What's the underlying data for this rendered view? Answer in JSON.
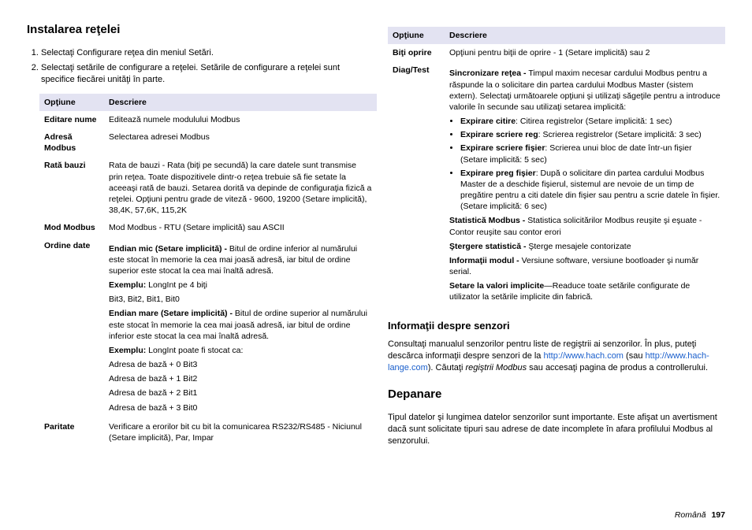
{
  "left": {
    "h2": "Instalarea reţelei",
    "steps": [
      "Selectaţi Configurare reţea din meniul Setări.",
      "Selectaţi setările de configurare a reţelei. Setările de configurare a reţelei sunt specifice fiecărei unităţi în parte."
    ],
    "th1": "Opţiune",
    "th2": "Descriere",
    "rows": {
      "editare_nume_k": "Editare nume",
      "editare_nume_v": "Editează numele modulului Modbus",
      "adresa_k": "Adresă Modbus",
      "adresa_v": "Selectarea adresei Modbus",
      "rata_k": "Rată bauzi",
      "rata_v": "Rata de bauzi - Rata (biţi pe secundă) la care datele sunt transmise prin reţea. Toate dispozitivele dintr-o reţea trebuie să fie setate la aceeaşi rată de bauzi. Setarea dorită va depinde de configuraţia fizică a reţelei. Opţiuni pentru grade de viteză - 9600, 19200 (Setare implicită), 38,4K, 57,6K, 115,2K",
      "mod_k": "Mod Modbus",
      "mod_v": "Mod Modbus - RTU (Setare implicită) sau ASCII",
      "ord_k": "Ordine date",
      "ord_little_b": "Endian mic (Setare implicită) - ",
      "ord_little_t": "Bitul de ordine inferior al numărului este stocat în memorie la cea mai joasă adresă, iar bitul de ordine superior este stocat la cea mai înaltă adresă.",
      "ord_ex_b": "Exemplu:",
      "ord_ex_t": " LongInt pe 4 biţi",
      "ord_bits": "Bit3, Bit2, Bit1, Bit0",
      "ord_big_b": "Endian mare (Setare implicită) - ",
      "ord_big_t": "Bitul de ordine superior al numărului este stocat în memorie la cea mai joasă adresă, iar bitul de ordine inferior este stocat la cea mai înaltă adresă.",
      "ord_ex2_t": " LongInt poate fi stocat ca:",
      "addr0": "Adresa de bază + 0 Bit3",
      "addr1": "Adresa de bază + 1 Bit2",
      "addr2": "Adresa de bază + 2 Bit1",
      "addr3": "Adresa de bază + 3 Bit0",
      "par_k": "Paritate",
      "par_v": "Verificare a erorilor bit cu bit la comunicarea RS232/RS485 - Niciunul (Setare implicită), Par, Impar"
    }
  },
  "right": {
    "th1": "Opţiune",
    "th2": "Descriere",
    "biti_k": "Biţi oprire",
    "biti_v": "Opţiuni pentru biţii de oprire - 1 (Setare implicită) sau 2",
    "diag_k": "Diag/Test",
    "diag_sync_b": "Sincronizare reţea - ",
    "diag_sync_t": "Timpul maxim necesar cardului Modbus pentru a răspunde la o solicitare din partea cardului Modbus Master (sistem extern). Selectaţi următoarele opţiuni şi utilizaţi săgeţile pentru a introduce valorile în secunde sau utilizaţi setarea implicită:",
    "bul": [
      {
        "b": "Expirare citire",
        "t": ": Citirea registrelor (Setare implicită: 1 sec)"
      },
      {
        "b": "Expirare scriere reg",
        "t": ": Scrierea registrelor (Setare implicită: 3 sec)"
      },
      {
        "b": "Expirare scriere fişier",
        "t": ": Scrierea unui bloc de date într-un fişier (Setare implicită: 5 sec)"
      },
      {
        "b": "Expirare preg fişier",
        "t": ": După o solicitare din partea cardului Modbus Master de a deschide fişierul, sistemul are nevoie de un timp de pregătire pentru a citi datele din fişier sau pentru a scrie datele în fişier. (Setare implicită: 6 sec)"
      }
    ],
    "stat_b": "Statistică Modbus - ",
    "stat_t": "Statistica solicitărilor Modbus reuşite şi eşuate - Contor reuşite sau contor erori",
    "sterg_b": "Ştergere statistică - ",
    "sterg_t": "Şterge mesajele contorizate",
    "info_b": "Informaţii modul - ",
    "info_t": "Versiune software, versiune bootloader şi număr serial.",
    "reset_b": "Setare la valori implicite",
    "reset_t": "—Readuce toate setările configurate de utilizator la setările implicite din fabrică.",
    "h3_senz": "Informaţii despre senzori",
    "senz_p1": "Consultaţi manualul senzorilor pentru liste de regiştrii ai senzorilor. În plus, puteţi descărca informaţii despre senzori de la ",
    "link1": "http://www.hach.com",
    "senz_p2": " (sau ",
    "link2": "http://www.hach-lange.com",
    "senz_p3": "). Căutaţi ",
    "senz_em": "regiştrii Modbus",
    "senz_p4": " sau accesaţi pagina de produs a controllerului.",
    "h2_dep": "Depanare",
    "dep_p": "Tipul datelor şi lungimea datelor senzorilor sunt importante. Este afişat un avertisment dacă sunt solicitate tipuri sau adrese de date incomplete în afara profilului Modbus al senzorului."
  },
  "footer_lang": "Română",
  "footer_page": "197"
}
